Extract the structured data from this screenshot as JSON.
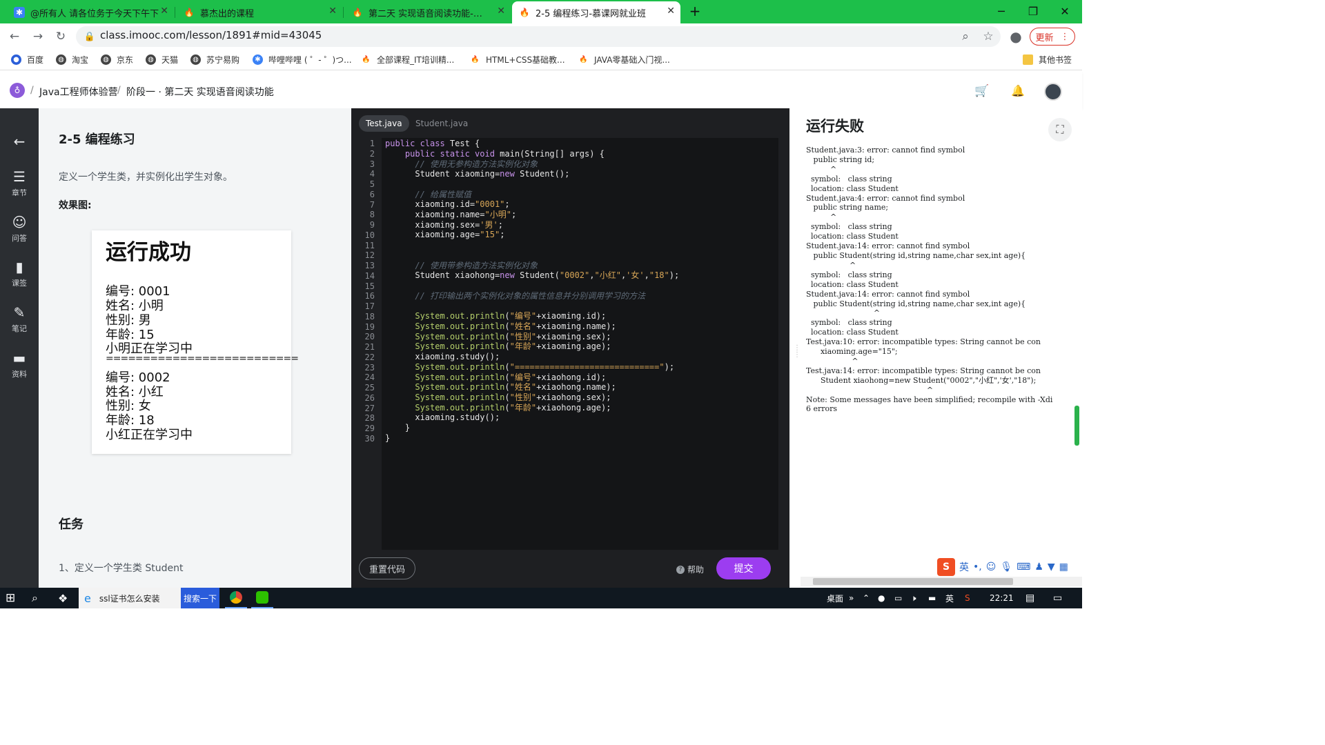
{
  "browser": {
    "tabs": [
      {
        "title": "@所有人 请各位务于今天下午下",
        "active": false
      },
      {
        "title": "慕杰出的课程",
        "active": false
      },
      {
        "title": "第二天 实现语音阅读功能-慕课网",
        "active": false
      },
      {
        "title": "2-5 编程练习-慕课网就业班",
        "active": true
      }
    ],
    "url": "class.imooc.com/lesson/1891#mid=43045",
    "update_label": "更新",
    "bookmarks": [
      "百度",
      "淘宝",
      "京东",
      "天猫",
      "苏宁易购",
      "哔哩哔哩 ( ゜- ゜)つ...",
      "全部课程_IT培训精...",
      "HTML+CSS基础教...",
      "JAVA零基础入门视..."
    ],
    "other_bookmarks": "其他书签"
  },
  "site": {
    "breadcrumb": [
      "Java工程师体验营",
      "阶段一 · 第二天 实现语音阅读功能"
    ]
  },
  "leftnav": [
    {
      "icon": "back-arrow-icon",
      "label": ""
    },
    {
      "icon": "chapter-icon",
      "label": "章节"
    },
    {
      "icon": "qa-icon",
      "label": "问答"
    },
    {
      "icon": "class-icon",
      "label": "课签"
    },
    {
      "icon": "note-icon",
      "label": "笔记"
    },
    {
      "icon": "folder-icon",
      "label": "资料"
    }
  ],
  "lesson": {
    "title": "2-5 编程练习",
    "description": "定义一个学生类，并实例化出学生对象。",
    "effect_label": "效果图:",
    "preview": {
      "heading": "运行成功",
      "lines": [
        "编号: 0001",
        "姓名: 小明",
        "性别: 男",
        "年龄: 15",
        "小明正在学习中",
        "==========================",
        "编号: 0002",
        "姓名: 小红",
        "性别: 女",
        "年龄: 18",
        "小红正在学习中"
      ]
    },
    "task_title": "任务",
    "task_item": "1、定义一个学生类 Student"
  },
  "editor": {
    "tabs": [
      "Test.java",
      "Student.java"
    ],
    "active_tab": "Test.java",
    "line_count": 30,
    "reset_label": "重置代码",
    "help_label": "帮助",
    "submit_label": "提交"
  },
  "output": {
    "title": "运行失败",
    "text": "Student.java:3: error: cannot find symbol\n   public string id;\n          ^\n  symbol:   class string\n  location: class Student\nStudent.java:4: error: cannot find symbol\n   public string name;\n          ^\n  symbol:   class string\n  location: class Student\nStudent.java:14: error: cannot find symbol\n   public Student(string id,string name,char sex,int age){\n                  ^\n  symbol:   class string\n  location: class Student\nStudent.java:14: error: cannot find symbol\n   public Student(string id,string name,char sex,int age){\n                            ^\n  symbol:   class string\n  location: class Student\nTest.java:10: error: incompatible types: String cannot be con\n      xiaoming.age=\"15\";\n                   ^\nTest.java:14: error: incompatible types: String cannot be con\n      Student xiaohong=new Student(\"0002\",\"小红\",'女',\"18\");\n                                                  ^\nNote: Some messages have been simplified; recompile with -Xdi\n6 errors"
  },
  "taskbar": {
    "search_text": "ssl证书怎么安装",
    "search_button": "搜索一下",
    "desktop_label": "桌面",
    "ime_label": "英",
    "clock": "22:21"
  }
}
